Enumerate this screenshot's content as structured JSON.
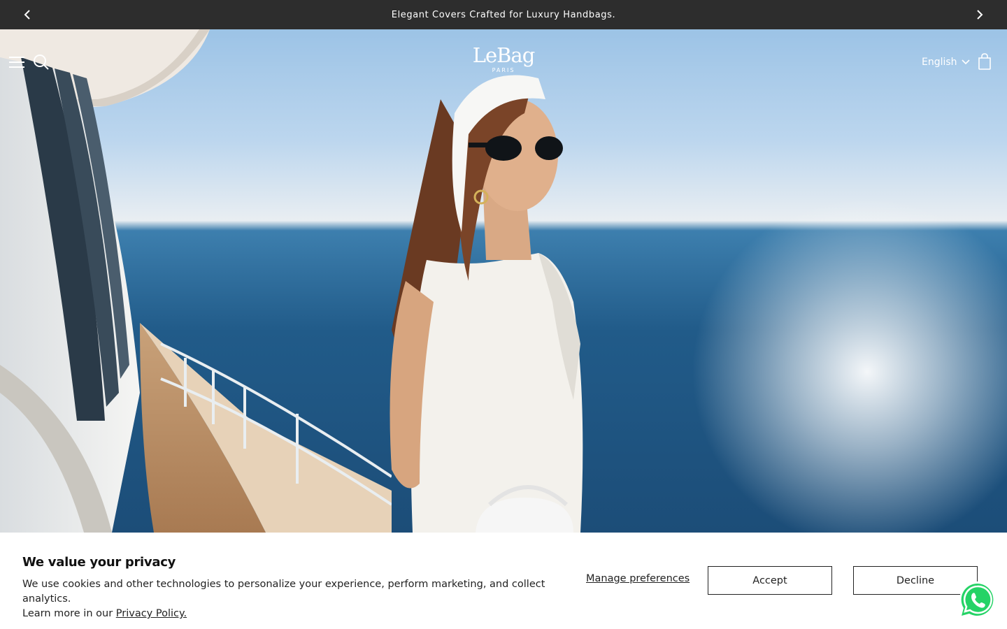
{
  "announcement": {
    "text": "Elegant Covers Crafted for Luxury Handbags.",
    "prev_icon": "chevron-left-icon",
    "next_icon": "chevron-right-icon"
  },
  "header": {
    "logo_main": "LeBag",
    "logo_sub": "PARIS",
    "language": "English",
    "icons": [
      "hamburger-menu-icon",
      "search-icon",
      "chevron-down-icon",
      "shopping-bag-icon"
    ]
  },
  "cookie_banner": {
    "title": "We value your privacy",
    "text_line1": "We use cookies and other technologies to personalize your experience, perform marketing, and collect analytics.",
    "text_line2_prefix": "Learn more in our ",
    "privacy_link": "Privacy Policy.",
    "manage_label": "Manage preferences",
    "accept_label": "Accept",
    "decline_label": "Decline"
  },
  "colors": {
    "announcement_bg": "#2d2d2d",
    "whatsapp_green": "#25D366",
    "text_dark": "#222222"
  },
  "widgets": {
    "chat_icon": "whatsapp-icon"
  }
}
